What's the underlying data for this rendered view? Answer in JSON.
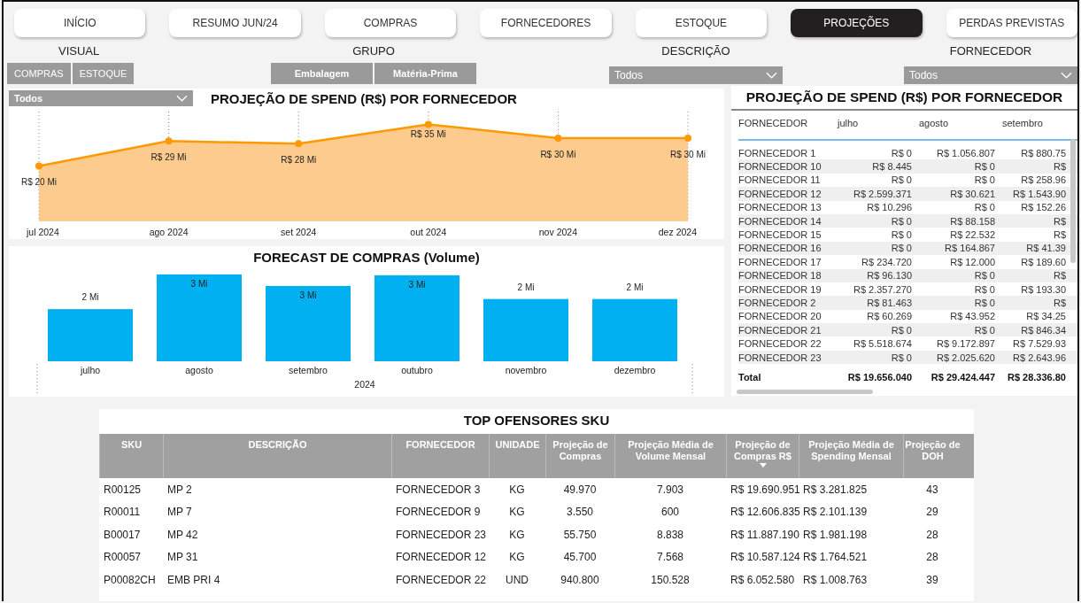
{
  "nav_tabs": [
    {
      "label": "INÍCIO",
      "selected": false
    },
    {
      "label": "RESUMO JUN/24",
      "selected": false
    },
    {
      "label": "COMPRAS",
      "selected": false
    },
    {
      "label": "FORNECEDORES",
      "selected": false
    },
    {
      "label": "ESTOQUE",
      "selected": false
    },
    {
      "label": "PROJEÇÕES",
      "selected": true
    },
    {
      "label": "PERDAS PREVISTAS",
      "selected": false
    }
  ],
  "filters": {
    "visual": {
      "label": "VISUAL",
      "options": [
        "COMPRAS",
        "ESTOQUE"
      ]
    },
    "grupo": {
      "label": "GRUPO",
      "options": [
        "Embalagem",
        "Matéria-Prima"
      ]
    },
    "descricao": {
      "label": "DESCRIÇÃO",
      "value": "Todos"
    },
    "fornecedor": {
      "label": "FORNECEDOR",
      "value": "Todos"
    }
  },
  "spend_chart": {
    "filter_value": "Todos",
    "chart_data": {
      "type": "line",
      "title": "PROJEÇÃO DE SPEND (R$) POR FORNECEDOR",
      "categories": [
        "jul 2024",
        "ago 2024",
        "set 2024",
        "out 2024",
        "nov 2024",
        "dez 2024"
      ],
      "grid": true,
      "series": [
        {
          "color": "#ff9900",
          "marker": true,
          "values": [
            20,
            29,
            28,
            35,
            30,
            30
          ],
          "value_labels": [
            "R$ 20 Mi",
            "R$ 29 Mi",
            "R$ 28 Mi",
            "R$ 35 Mi",
            "R$ 30 Mi",
            "R$ 30 Mi"
          ]
        }
      ]
    }
  },
  "forecast_chart": {
    "chart_data": {
      "type": "bar",
      "title": "FORECAST DE COMPRAS (Volume)",
      "xlabel": "2024",
      "categories": [
        "julho",
        "agosto",
        "setembro",
        "outubro",
        "novembro",
        "dezembro"
      ],
      "series": [
        {
          "color": "#00b0f0",
          "values": [
            1.8,
            3.0,
            2.6,
            2.97,
            2.15,
            2.15
          ],
          "value_labels": [
            "2 Mi",
            "3 Mi",
            "3 Mi",
            "3 Mi",
            "2 Mi",
            "2 Mi"
          ]
        }
      ]
    }
  },
  "spend_table": {
    "title": "PROJEÇÃO DE SPEND (R$) POR FORNECEDOR",
    "columns": [
      "FORNECEDOR",
      "julho",
      "agosto",
      "setembro"
    ],
    "rows": [
      [
        "FORNECEDOR 1",
        "R$ 0",
        "R$ 1.056.807",
        "R$ 880.75"
      ],
      [
        "FORNECEDOR 10",
        "R$ 8.445",
        "R$ 0",
        "R$"
      ],
      [
        "FORNECEDOR 11",
        "R$ 0",
        "R$ 0",
        "R$ 258.96"
      ],
      [
        "FORNECEDOR 12",
        "R$ 2.599.371",
        "R$ 30.621",
        "R$ 1.543.90"
      ],
      [
        "FORNECEDOR 13",
        "R$ 10.296",
        "R$ 0",
        "R$ 152.26"
      ],
      [
        "FORNECEDOR 14",
        "R$ 0",
        "R$ 88.158",
        "R$"
      ],
      [
        "FORNECEDOR 15",
        "R$ 0",
        "R$ 22.532",
        "R$"
      ],
      [
        "FORNECEDOR 16",
        "R$ 0",
        "R$ 164.867",
        "R$ 41.39"
      ],
      [
        "FORNECEDOR 17",
        "R$ 234.720",
        "R$ 12.000",
        "R$ 189.60"
      ],
      [
        "FORNECEDOR 18",
        "R$ 96.130",
        "R$ 0",
        "R$"
      ],
      [
        "FORNECEDOR 19",
        "R$ 2.357.270",
        "R$ 0",
        "R$ 193.30"
      ],
      [
        "FORNECEDOR 2",
        "R$ 81.463",
        "R$ 0",
        "R$"
      ],
      [
        "FORNECEDOR 20",
        "R$ 60.269",
        "R$ 43.952",
        "R$ 34.25"
      ],
      [
        "FORNECEDOR 21",
        "R$ 0",
        "R$ 0",
        "R$ 846.34"
      ],
      [
        "FORNECEDOR 22",
        "R$ 5.518.674",
        "R$ 9.172.897",
        "R$ 7.529.93"
      ],
      [
        "FORNECEDOR 23",
        "R$ 0",
        "R$ 2.025.620",
        "R$ 2.643.96"
      ]
    ],
    "total": [
      "Total",
      "R$ 19.656.040",
      "R$ 29.424.447",
      "R$ 28.336.80"
    ]
  },
  "top_offenders": {
    "title": "TOP OFENSORES SKU",
    "columns": [
      {
        "label": "SKU",
        "sorted": false
      },
      {
        "label": "DESCRIÇÃO",
        "sorted": false
      },
      {
        "label": "FORNECEDOR",
        "sorted": false
      },
      {
        "label": "UNIDADE",
        "sorted": false
      },
      {
        "label": "Projeção de Compras",
        "sorted": false
      },
      {
        "label": "Projeção Média de Volume Mensal",
        "sorted": false
      },
      {
        "label": "Projeção de Compras R$",
        "sorted": true
      },
      {
        "label": "Projeção Média de Spending Mensal",
        "sorted": false
      },
      {
        "label": "Projeção de DOH",
        "sorted": false
      }
    ],
    "rows": [
      [
        "R00125",
        "MP 2",
        "FORNECEDOR 3",
        "KG",
        "49.970",
        "7.903",
        "R$ 19.690.951",
        "R$ 3.281.825",
        "43"
      ],
      [
        "R00011",
        "MP 7",
        "FORNECEDOR 9",
        "KG",
        "3.550",
        "600",
        "R$ 12.606.835",
        "R$ 2.101.139",
        "29"
      ],
      [
        "B00017",
        "MP 42",
        "FORNECEDOR 23",
        "KG",
        "55.750",
        "8.838",
        "R$ 11.887.190",
        "R$ 1.981.198",
        "28"
      ],
      [
        "R00057",
        "MP 31",
        "FORNECEDOR 12",
        "KG",
        "45.700",
        "7.568",
        "R$ 10.587.124",
        "R$ 1.764.521",
        "28"
      ],
      [
        "P00082CH",
        "EMB PRI 4",
        "FORNECEDOR 22",
        "UND",
        "940.800",
        "150.528",
        "R$ 6.052.580",
        "R$ 1.008.763",
        "39"
      ]
    ]
  }
}
